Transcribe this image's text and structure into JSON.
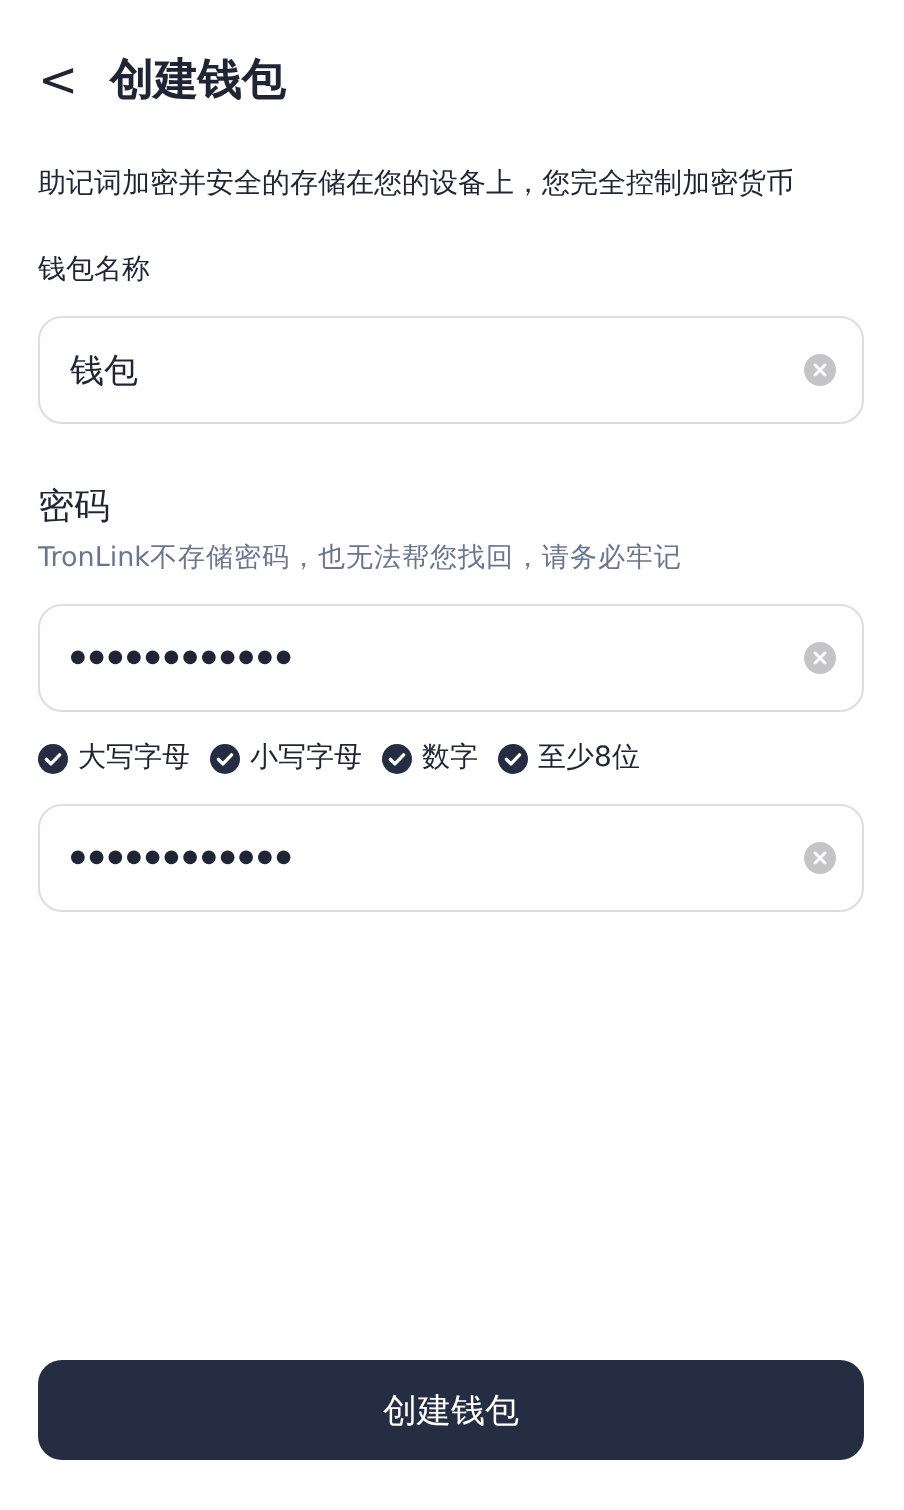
{
  "header": {
    "back": "<",
    "title": "创建钱包"
  },
  "description": "助记词加密并安全的存储在您的设备上，您完全控制加密货币",
  "wallet_name": {
    "label": "钱包名称",
    "value": "钱包"
  },
  "password": {
    "label": "密码",
    "hint": "TronLink不存储密码，也无法帮您找回，请务必牢记",
    "value": "●●●●●●●●●●●●"
  },
  "rules": [
    {
      "label": "大写字母",
      "checked": true
    },
    {
      "label": "小写字母",
      "checked": true
    },
    {
      "label": "数字",
      "checked": true
    },
    {
      "label": "至少8位",
      "checked": true
    }
  ],
  "confirm_password": {
    "value": "●●●●●●●●●●●●"
  },
  "submit_button": "创建钱包"
}
